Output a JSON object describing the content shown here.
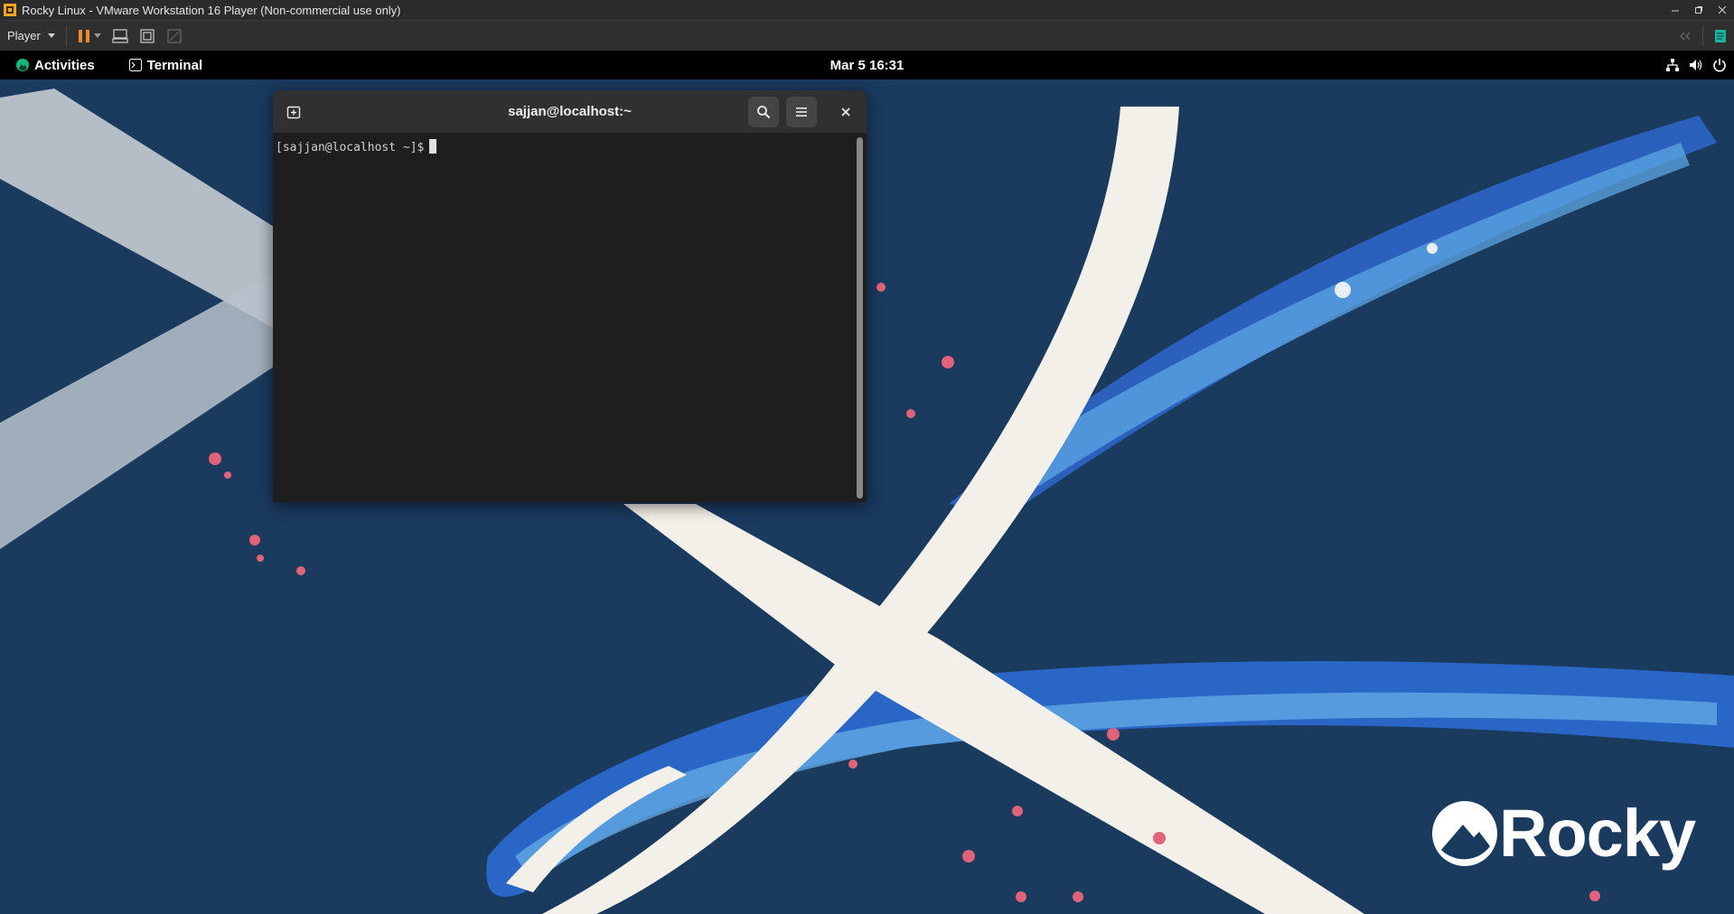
{
  "vm_titlebar": {
    "title": "Rocky Linux - VMware Workstation 16 Player (Non-commercial use only)"
  },
  "vm_toolbar": {
    "player_label": "Player"
  },
  "gnome_bar": {
    "activities_label": "Activities",
    "app_label": "Terminal",
    "clock": "Mar 5  16:31"
  },
  "terminal": {
    "title": "sajjan@localhost:~",
    "prompt": "[sajjan@localhost ~]$"
  },
  "branding": {
    "wordmark": "Rocky"
  },
  "colors": {
    "wallpaper": "#1a3a5e",
    "accent_green": "#10b981",
    "vm_pause_orange": "#f28c28"
  }
}
